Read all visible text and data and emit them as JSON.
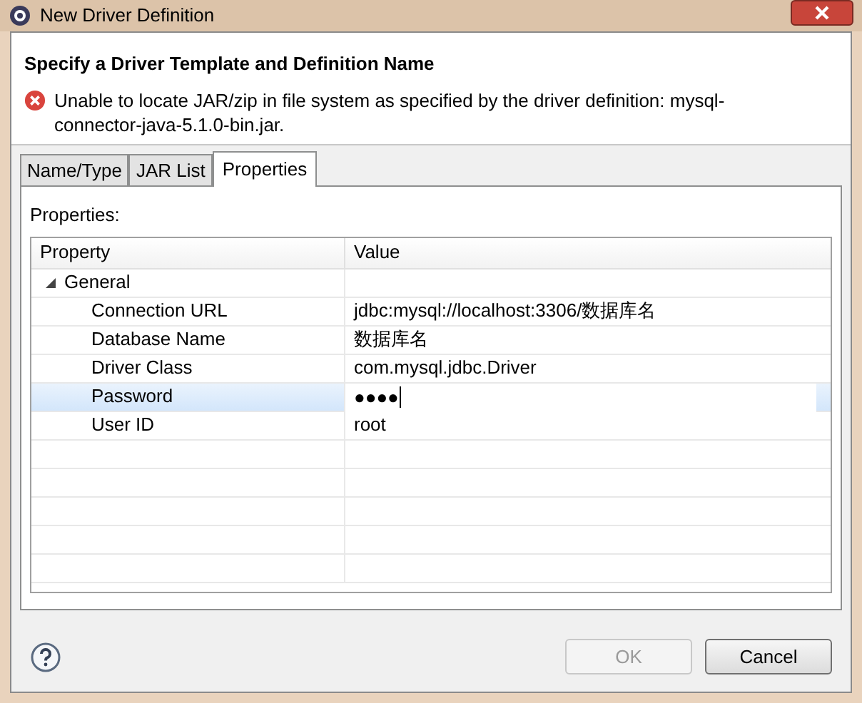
{
  "window": {
    "title": "New Driver Definition"
  },
  "header": {
    "title": "Specify a Driver Template and Definition Name",
    "error": "Unable to locate JAR/zip in file system as specified by the driver definition: mysql-connector-java-5.1.0-bin.jar."
  },
  "tabs": [
    {
      "label": "Name/Type",
      "selected": false
    },
    {
      "label": "JAR List",
      "selected": false
    },
    {
      "label": "Properties",
      "selected": true
    }
  ],
  "properties": {
    "label": "Properties:",
    "columns": [
      "Property",
      "Value"
    ],
    "groups": [
      {
        "name": "General",
        "expanded": true,
        "children": [
          {
            "name": "Connection URL",
            "value": "jdbc:mysql://localhost:3306/数据库名",
            "selected": false
          },
          {
            "name": "Database Name",
            "value": "数据库名",
            "selected": false
          },
          {
            "name": "Driver Class",
            "value": "com.mysql.jdbc.Driver",
            "selected": false
          },
          {
            "name": "Password",
            "value": "●●●●",
            "selected": true
          },
          {
            "name": "User ID",
            "value": "root",
            "selected": false
          }
        ]
      }
    ]
  },
  "buttons": [
    {
      "label": "OK",
      "disabled": true
    },
    {
      "label": "Cancel",
      "disabled": false
    }
  ]
}
